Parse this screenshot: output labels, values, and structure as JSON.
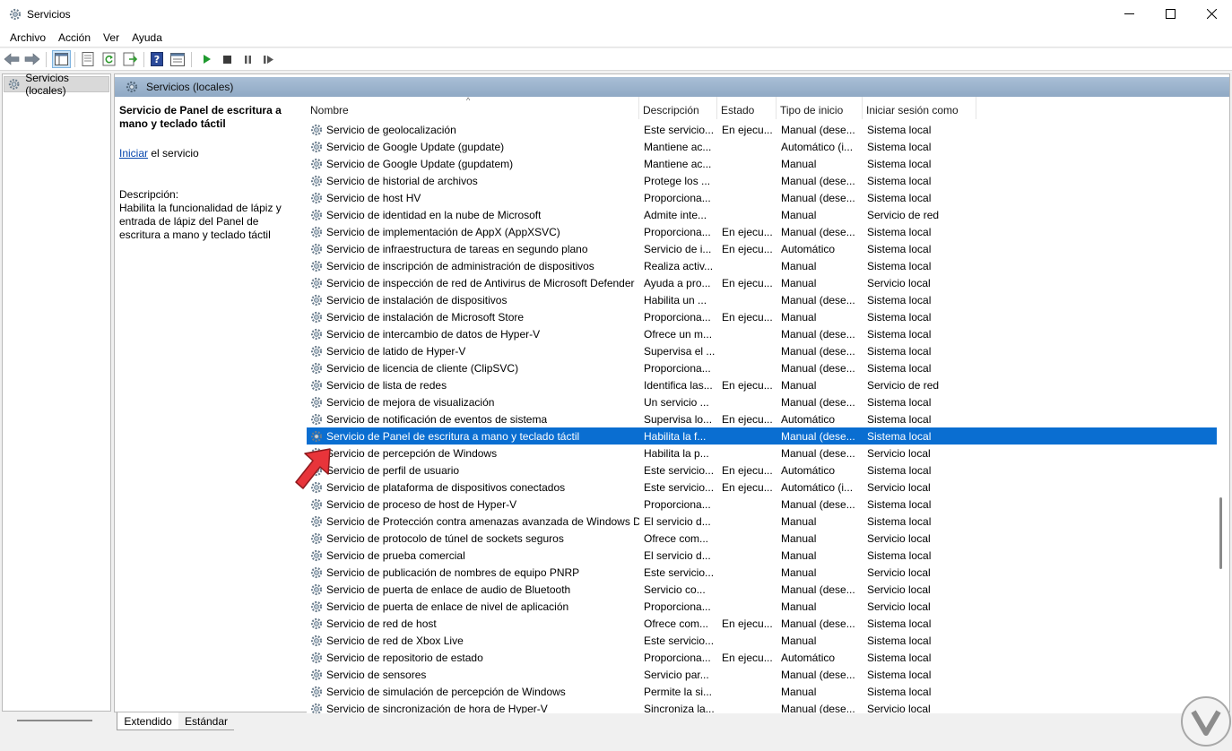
{
  "window": {
    "title": "Servicios"
  },
  "menu": [
    "Archivo",
    "Acción",
    "Ver",
    "Ayuda"
  ],
  "tree": {
    "root_label": "Servicios (locales)"
  },
  "pane": {
    "header_label": "Servicios (locales)"
  },
  "details": {
    "title": "Servicio de Panel de escritura a mano y teclado táctil",
    "action_link": "Iniciar",
    "action_rest": " el servicio",
    "description_label": "Descripción:",
    "description_text": "Habilita la funcionalidad de lápiz y entrada de lápiz del Panel de escritura a mano y teclado táctil"
  },
  "columns": [
    "Nombre",
    "Descripción",
    "Estado",
    "Tipo de inicio",
    "Iniciar sesión como"
  ],
  "rows": [
    {
      "name": "Servicio de geolocalización",
      "desc": "Este servicio...",
      "state": "En ejecu...",
      "start": "Manual (dese...",
      "logon": "Sistema local"
    },
    {
      "name": "Servicio de Google Update (gupdate)",
      "desc": "Mantiene ac...",
      "state": "",
      "start": "Automático (i...",
      "logon": "Sistema local"
    },
    {
      "name": "Servicio de Google Update (gupdatem)",
      "desc": "Mantiene ac...",
      "state": "",
      "start": "Manual",
      "logon": "Sistema local"
    },
    {
      "name": "Servicio de historial de archivos",
      "desc": "Protege los ...",
      "state": "",
      "start": "Manual (dese...",
      "logon": "Sistema local"
    },
    {
      "name": "Servicio de host HV",
      "desc": "Proporciona...",
      "state": "",
      "start": "Manual (dese...",
      "logon": "Sistema local"
    },
    {
      "name": "Servicio de identidad en la nube de Microsoft",
      "desc": "Admite inte...",
      "state": "",
      "start": "Manual",
      "logon": "Servicio de red"
    },
    {
      "name": "Servicio de implementación de AppX (AppXSVC)",
      "desc": "Proporciona...",
      "state": "En ejecu...",
      "start": "Manual (dese...",
      "logon": "Sistema local"
    },
    {
      "name": "Servicio de infraestructura de tareas en segundo plano",
      "desc": "Servicio de i...",
      "state": "En ejecu...",
      "start": "Automático",
      "logon": "Sistema local"
    },
    {
      "name": "Servicio de inscripción de administración de dispositivos",
      "desc": "Realiza activ...",
      "state": "",
      "start": "Manual",
      "logon": "Sistema local"
    },
    {
      "name": "Servicio de inspección de red de Antivirus de Microsoft Defender",
      "desc": "Ayuda a pro...",
      "state": "En ejecu...",
      "start": "Manual",
      "logon": "Servicio local"
    },
    {
      "name": "Servicio de instalación de dispositivos",
      "desc": "Habilita un ...",
      "state": "",
      "start": "Manual (dese...",
      "logon": "Sistema local"
    },
    {
      "name": "Servicio de instalación de Microsoft Store",
      "desc": "Proporciona...",
      "state": "En ejecu...",
      "start": "Manual",
      "logon": "Sistema local"
    },
    {
      "name": "Servicio de intercambio de datos de Hyper-V",
      "desc": "Ofrece un m...",
      "state": "",
      "start": "Manual (dese...",
      "logon": "Sistema local"
    },
    {
      "name": "Servicio de latido de Hyper-V",
      "desc": "Supervisa el ...",
      "state": "",
      "start": "Manual (dese...",
      "logon": "Sistema local"
    },
    {
      "name": "Servicio de licencia de cliente (ClipSVC)",
      "desc": "Proporciona...",
      "state": "",
      "start": "Manual (dese...",
      "logon": "Sistema local"
    },
    {
      "name": "Servicio de lista de redes",
      "desc": "Identifica las...",
      "state": "En ejecu...",
      "start": "Manual",
      "logon": "Servicio de red"
    },
    {
      "name": "Servicio de mejora de visualización",
      "desc": "Un servicio ...",
      "state": "",
      "start": "Manual (dese...",
      "logon": "Sistema local"
    },
    {
      "name": "Servicio de notificación de eventos de sistema",
      "desc": "Supervisa lo...",
      "state": "En ejecu...",
      "start": "Automático",
      "logon": "Sistema local"
    },
    {
      "name": "Servicio de Panel de escritura a mano y teclado táctil",
      "desc": "Habilita la f...",
      "state": "",
      "start": "Manual (dese...",
      "logon": "Sistema local",
      "selected": true
    },
    {
      "name": "Servicio de percepción de Windows",
      "desc": "Habilita la p...",
      "state": "",
      "start": "Manual (dese...",
      "logon": "Servicio local"
    },
    {
      "name": "Servicio de perfil de usuario",
      "desc": "Este servicio...",
      "state": "En ejecu...",
      "start": "Automático",
      "logon": "Sistema local"
    },
    {
      "name": "Servicio de plataforma de dispositivos conectados",
      "desc": "Este servicio...",
      "state": "En ejecu...",
      "start": "Automático (i...",
      "logon": "Servicio local"
    },
    {
      "name": "Servicio de proceso de host de Hyper-V",
      "desc": "Proporciona...",
      "state": "",
      "start": "Manual (dese...",
      "logon": "Sistema local"
    },
    {
      "name": "Servicio de Protección contra amenazas avanzada de Windows D...",
      "desc": "El servicio d...",
      "state": "",
      "start": "Manual",
      "logon": "Sistema local"
    },
    {
      "name": "Servicio de protocolo de túnel de sockets seguros",
      "desc": "Ofrece com...",
      "state": "",
      "start": "Manual",
      "logon": "Servicio local"
    },
    {
      "name": "Servicio de prueba comercial",
      "desc": "El servicio d...",
      "state": "",
      "start": "Manual",
      "logon": "Sistema local"
    },
    {
      "name": "Servicio de publicación de nombres de equipo PNRP",
      "desc": "Este servicio...",
      "state": "",
      "start": "Manual",
      "logon": "Servicio local"
    },
    {
      "name": "Servicio de puerta de enlace de audio de Bluetooth",
      "desc": "Servicio co...",
      "state": "",
      "start": "Manual (dese...",
      "logon": "Servicio local"
    },
    {
      "name": "Servicio de puerta de enlace de nivel de aplicación",
      "desc": "Proporciona...",
      "state": "",
      "start": "Manual",
      "logon": "Servicio local"
    },
    {
      "name": "Servicio de red de host",
      "desc": "Ofrece com...",
      "state": "En ejecu...",
      "start": "Manual (dese...",
      "logon": "Sistema local"
    },
    {
      "name": "Servicio de red de Xbox Live",
      "desc": "Este servicio...",
      "state": "",
      "start": "Manual",
      "logon": "Sistema local"
    },
    {
      "name": "Servicio de repositorio de estado",
      "desc": "Proporciona...",
      "state": "En ejecu...",
      "start": "Automático",
      "logon": "Sistema local"
    },
    {
      "name": "Servicio de sensores",
      "desc": "Servicio par...",
      "state": "",
      "start": "Manual (dese...",
      "logon": "Sistema local"
    },
    {
      "name": "Servicio de simulación de percepción de Windows",
      "desc": "Permite la si...",
      "state": "",
      "start": "Manual",
      "logon": "Sistema local"
    },
    {
      "name": "Servicio de sincronización de hora de Hyper-V",
      "desc": "Sincroniza la...",
      "state": "",
      "start": "Manual (dese...",
      "logon": "Servicio local"
    }
  ],
  "tabs": [
    "Extendido",
    "Estándar"
  ],
  "colors": {
    "selection": "#0a6ed1",
    "pane_header": "#9fb6ce",
    "arrow": "#e8343a"
  }
}
